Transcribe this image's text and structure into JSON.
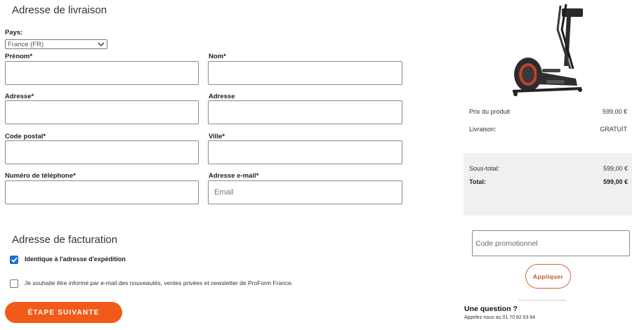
{
  "shipping": {
    "title": "Adresse de livraison",
    "country_label": "Pays:",
    "country_value": "France (FR)",
    "first_name_label": "Prénom*",
    "last_name_label": "Nom*",
    "address_label": "Adresse*",
    "address2_label": "Adresse",
    "postcode_label": "Code postal*",
    "city_label": "Ville*",
    "phone_label": "Numéro de téléphone*",
    "email_label": "Adresse e-mail*",
    "email_placeholder": "Email"
  },
  "billing": {
    "title": "Adresse de facturation",
    "same_address_label": "Identique à l'adresse d'expédition",
    "same_address_checked": true,
    "newsletter_label": "Je souhaite être informé par e-mail des nouveautés, ventes privées et newsletter de ProForm France.",
    "newsletter_checked": false
  },
  "next_button": "ÉTAPE SUIVANTE",
  "summary": {
    "product_price_label": "Prix du produit",
    "product_price_value": "599,00 €",
    "delivery_label": "Livraison:",
    "delivery_value": "GRATUIT",
    "subtotal_label": "Sous-total:",
    "subtotal_value": "599,00 €",
    "total_label": "Total:",
    "total_value": "599,00 €"
  },
  "promo": {
    "placeholder": "Code promotionnel",
    "apply_button": "Appliquer"
  },
  "help": {
    "title": "Une question ?",
    "text": "Appelez-nous au 01 70 82 63 64"
  },
  "colors": {
    "accent": "#f25a1a",
    "checkbox": "#1a6fd6",
    "summary_bg": "#f0f0f0"
  },
  "icons": [
    "chevron-down-icon",
    "checkmark-icon",
    "elliptical-product-image"
  ]
}
